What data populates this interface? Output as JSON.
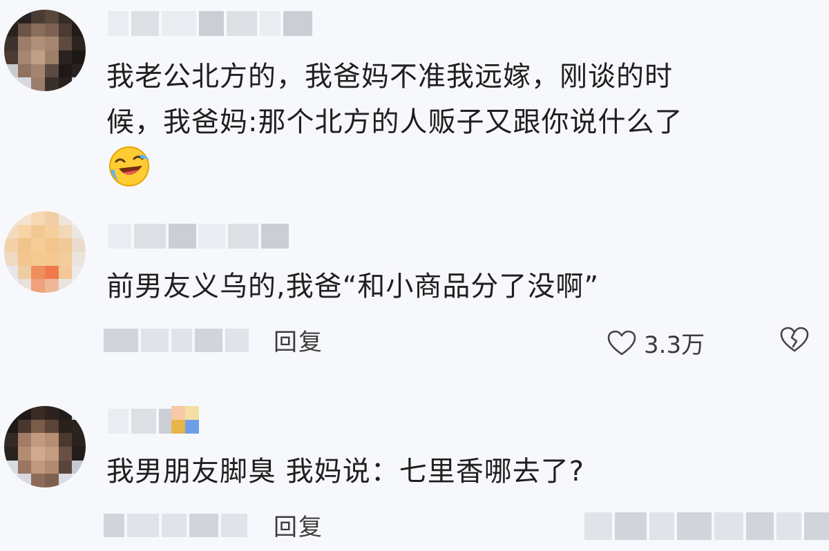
{
  "comments": [
    {
      "text_lines": [
        "我老公北方的，我爸妈不准我远嫁，刚谈的时",
        "候，我爸妈:那个北方的人贩子又跟你说什么了"
      ],
      "emoji": "laughing-crying-emoji"
    },
    {
      "text": "前男友义乌的,我爸“和小商品分了没啊”",
      "reply_label": "回复",
      "like_count": "3.3万"
    },
    {
      "text": "我男朋友脚臭 我妈说：七里香哪去了?",
      "reply_label": "回复"
    }
  ],
  "colors": {
    "background": "#f7f8fc",
    "text": "#1f1f1f",
    "meta": "#3b3b3b"
  }
}
